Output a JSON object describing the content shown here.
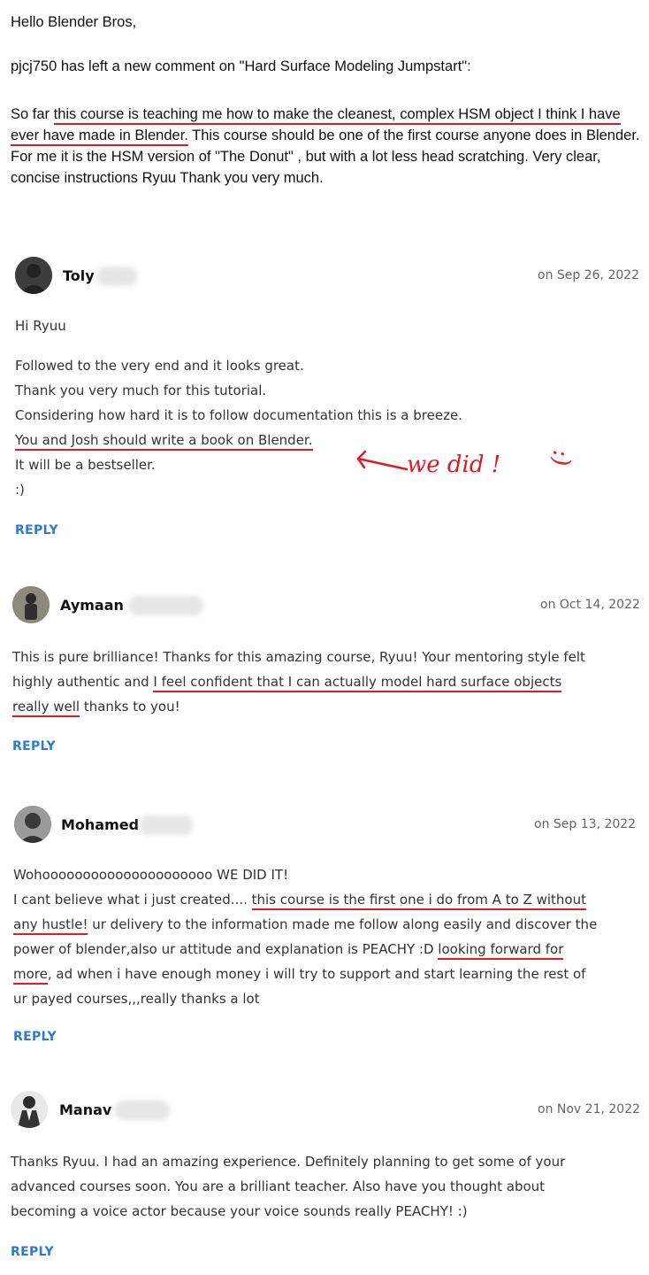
{
  "email": {
    "greeting": "Hello Blender Bros,",
    "intro": "pjcj750 has left a new comment on \"Hard Surface Modeling Jumpstart\":",
    "body_prefix": "So far ",
    "body_highlight": "this course is teaching me how to make the cleanest, complex HSM object I think I have ever have made in Blender.",
    "body_rest": " This course should be one of the first course anyone does in Blender. For me it is the HSM version of \"The Donut\" , but with a lot less head scratching. Very clear, concise instructions Ryuu Thank you very much."
  },
  "comments": [
    {
      "author": "Toly",
      "date": "on Sep 26, 2022",
      "lines": {
        "l1": "Hi Ryuu",
        "l2": "Followed to the very end and it looks great.",
        "l3": "Thank you very much for this tutorial.",
        "l4": "Considering how hard it is to follow documentation this is a breeze.",
        "l5": "You and Josh should write a book on Blender.",
        "l6": "It will be a bestseller.",
        "l7": ":)"
      },
      "reply": "REPLY"
    },
    {
      "author": "Aymaan",
      "date": "on Oct 14, 2022",
      "lines": {
        "l1a": "This is pure brilliance! Thanks for this amazing course, Ryuu! Your mentoring style felt",
        "l2a": "highly authentic and ",
        "l2b": "I feel confident that I can actually model hard surface objects",
        "l3a": "really well",
        "l3b": " thanks to you!"
      },
      "reply": "REPLY"
    },
    {
      "author": "Mohamed",
      "date": "on Sep 13, 2022",
      "lines": {
        "l1": "Wohooooooooooooooooooooo WE DID IT!",
        "l2a": "I cant believe what i just created.... ",
        "l2b": "this course is the first one i do from A to Z without",
        "l3a": "any hustle!",
        "l3b": " ur delivery to the information made me follow along easily and discover the",
        "l4a": "power of blender,also ur attitude and explanation is PEACHY :D ",
        "l4b": "looking forward for",
        "l5a": "more",
        "l5b": ", ad when i have enough money i will try to support and start learning the rest of",
        "l6": "ur payed courses,,,really thanks a lot"
      },
      "reply": "REPLY"
    },
    {
      "author": "Manav",
      "date": "on Nov 21, 2022",
      "lines": {
        "l1": "Thanks Ryuu. I had an amazing experience. Definitely planning to get some of your",
        "l2": "advanced courses soon. You are a brilliant teacher. Also have you thought about",
        "l3": "becoming a voice actor because your voice sounds really PEACHY! :)"
      },
      "reply": "REPLY"
    }
  ],
  "annotation": {
    "text": "we did !",
    "smiley": ":)"
  },
  "colors": {
    "underline": "#e01b24",
    "reply": "#2b7bd1"
  }
}
